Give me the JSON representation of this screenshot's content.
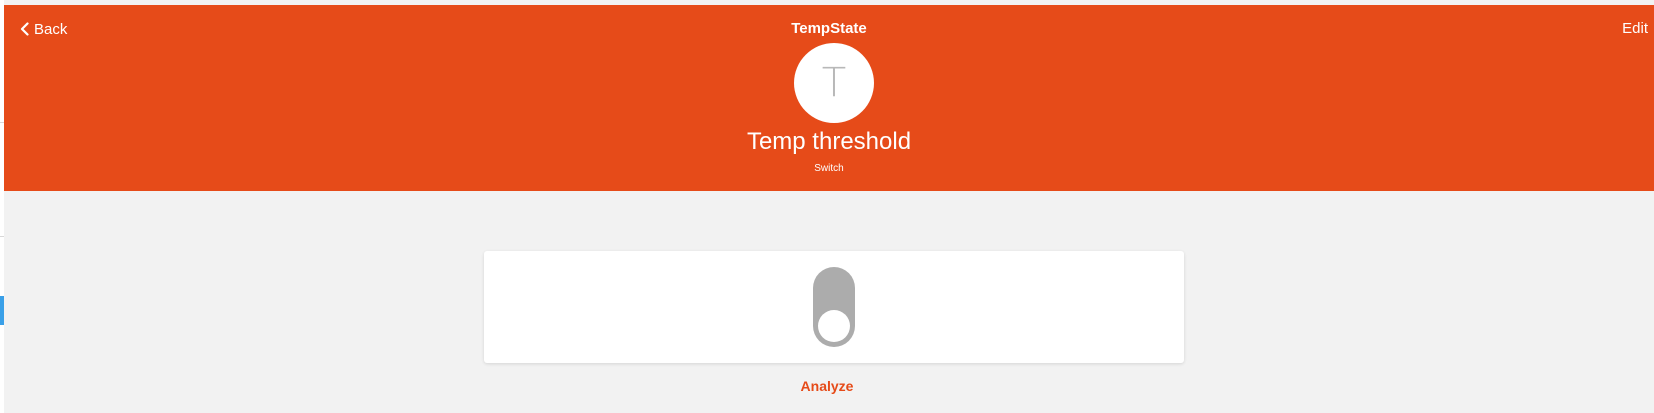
{
  "header": {
    "back_label": "Back",
    "title": "TempState",
    "edit_label": "Edit",
    "background_color": "#e64b19"
  },
  "device": {
    "avatar_letter": "T",
    "name": "Temp threshold",
    "type": "Switch"
  },
  "control": {
    "type": "toggle-switch",
    "state": "off"
  },
  "footer": {
    "analyze_label": "Analyze"
  },
  "colors": {
    "accent": "#e64b19",
    "toggle_off": "#acacac",
    "sidebar_accent": "#3aa0e8"
  },
  "icons": {
    "back": "chevron-left-icon"
  }
}
